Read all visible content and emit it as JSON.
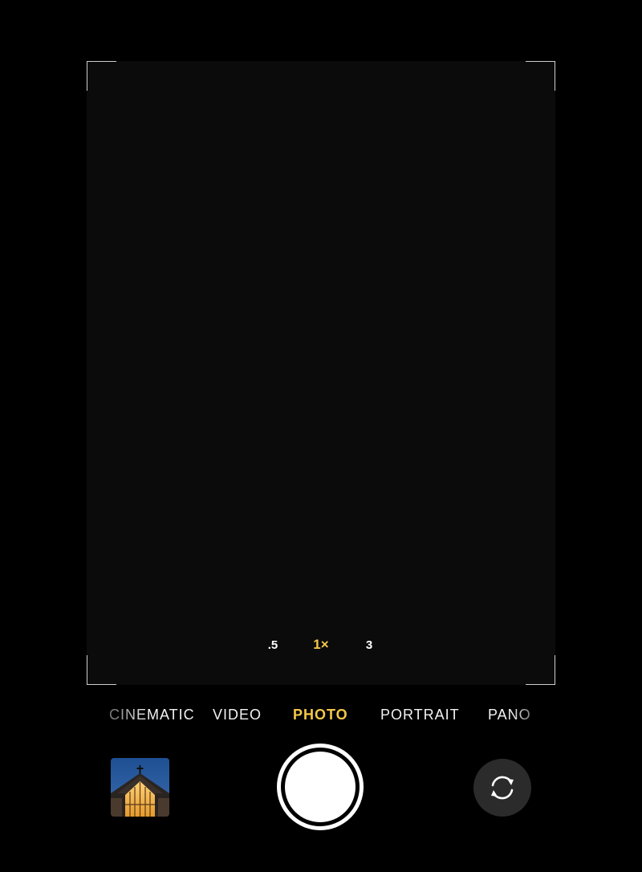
{
  "zoom": {
    "options": [
      ".5",
      "1×",
      "3"
    ],
    "selected": "1×"
  },
  "modes": {
    "items": [
      "CINEMATIC",
      "VIDEO",
      "PHOTO",
      "PORTRAIT",
      "PANO"
    ],
    "selected": "PHOTO"
  },
  "controls": {
    "thumbnail_icon": "last-photo-thumbnail",
    "shutter_icon": "shutter-button",
    "flip_icon": "camera-flip-icon"
  },
  "colors": {
    "accent": "#f4c84b",
    "background": "#000000",
    "viewfinder": "#0b0b0b",
    "flip_button_bg": "#2b2b2b"
  }
}
